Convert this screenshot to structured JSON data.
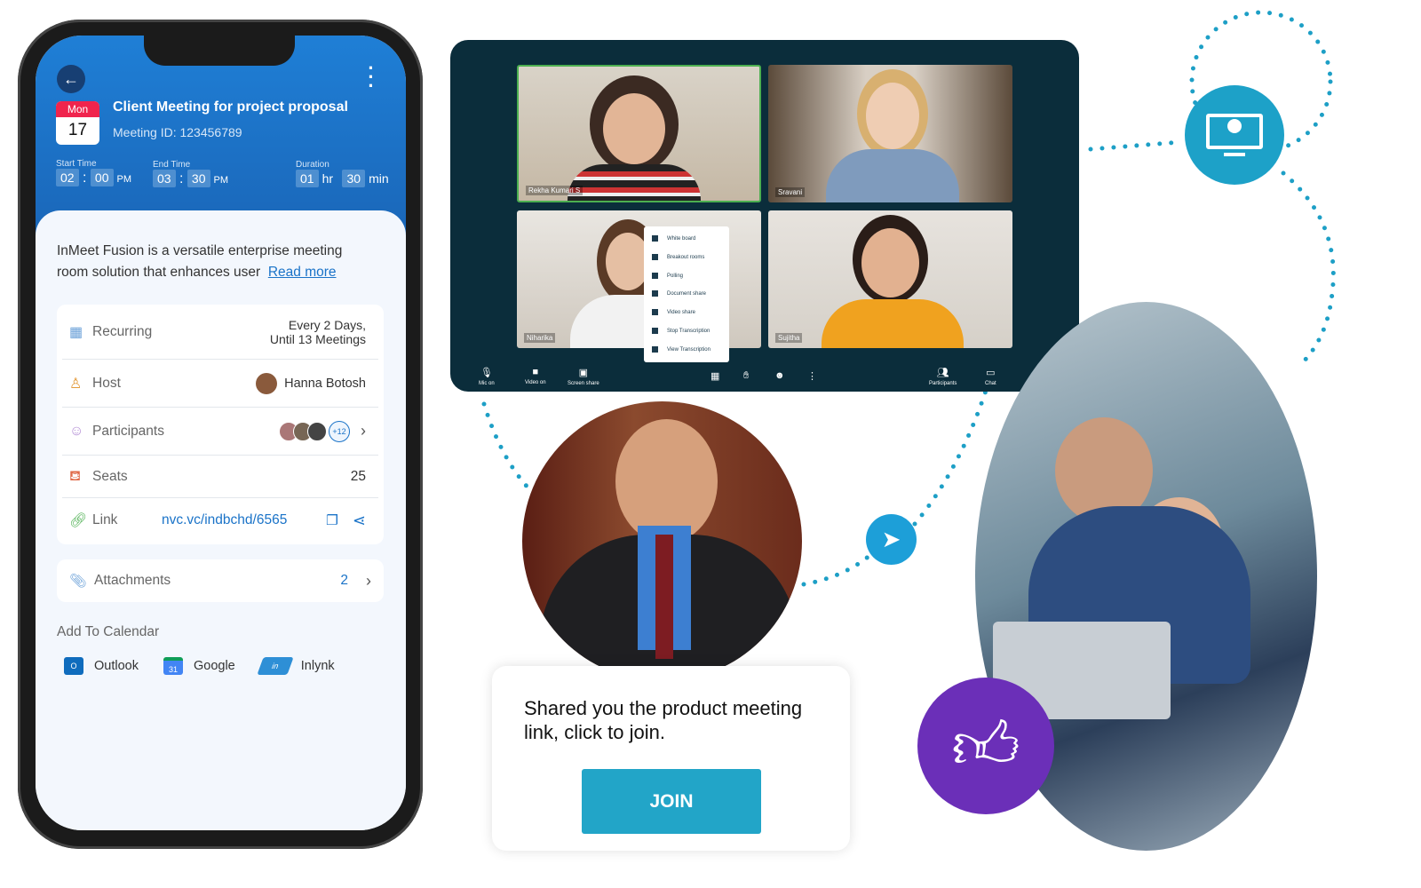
{
  "phone": {
    "date": {
      "day": "Mon",
      "num": "17"
    },
    "title": "Client Meeting for project proposal",
    "meeting_id": "Meeting ID: 123456789",
    "start": {
      "label": "Start Time",
      "h": "02",
      "m": "00",
      "ampm": "PM"
    },
    "end": {
      "label": "End Time",
      "h": "03",
      "m": "30",
      "ampm": "PM"
    },
    "duration": {
      "label": "Duration",
      "hr": "01",
      "hr_unit": "hr",
      "min": "30",
      "min_unit": "min"
    },
    "description": "InMeet Fusion is a versatile enterprise meeting room solution that enhances user",
    "read_more": "Read more",
    "rows": {
      "recurring": {
        "label": "Recurring",
        "value1": "Every 2 Days,",
        "value2": "Until 13 Meetings"
      },
      "host": {
        "label": "Host",
        "value": "Hanna Botosh"
      },
      "participants": {
        "label": "Participants",
        "extra": "+12"
      },
      "seats": {
        "label": "Seats",
        "value": "25"
      },
      "link": {
        "label": "Link",
        "value": "nvc.vc/indbchd/6565"
      }
    },
    "attachments": {
      "label": "Attachments",
      "count": "2"
    },
    "add_to_calendar": "Add To Calendar",
    "calendars": [
      "Outlook",
      "Google",
      "Inlynk"
    ]
  },
  "video": {
    "tiles": [
      "Rekha Kumari S",
      "Sravani",
      "Niharika",
      "Sujitha"
    ],
    "menu": [
      "White board",
      "Breakout rooms",
      "Polling",
      "Document share",
      "Video share",
      "Stop Transcription",
      "View Transcription"
    ],
    "toolbar": {
      "mic": "Mic on",
      "video": "Video on",
      "share": "Screen share",
      "participants": "Participants",
      "chat": "Chat"
    }
  },
  "card": {
    "message": "Shared you the product meeting link, click to join.",
    "join": "JOIN"
  },
  "colors": {
    "accent": "#22a5c8",
    "phone_header": "#1f7fd6",
    "video_bg": "#0b2d3b",
    "thumbs": "#6b2fb8"
  }
}
